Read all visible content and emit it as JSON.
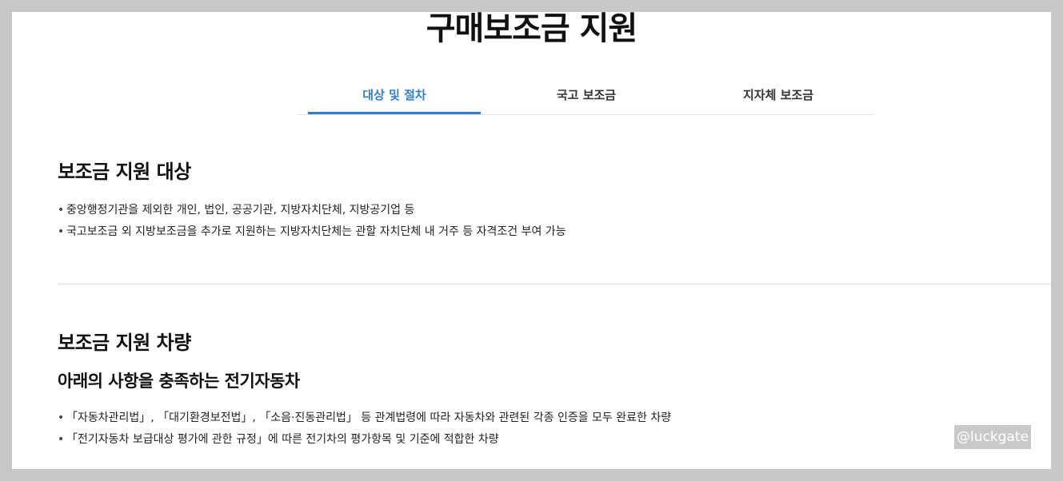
{
  "page": {
    "title": "구매보조금 지원"
  },
  "tabs": [
    {
      "label": "대상 및 절차",
      "active": true
    },
    {
      "label": "국고 보조금",
      "active": false
    },
    {
      "label": "지자체 보조금",
      "active": false
    }
  ],
  "colors": {
    "accent": "#2f7fd1",
    "frame": "#c8c8c8"
  },
  "section1": {
    "heading": "보조금 지원 대상",
    "items": [
      "중앙행정기관을 제외한 개인, 법인, 공공기관, 지방자치단체, 지방공기업 등",
      "국고보조금 외 지방보조금을 추가로 지원하는 지방자치단체는 관할 자치단체 내 거주 등 자격조건 부여 가능"
    ]
  },
  "section2": {
    "heading": "보조금 지원 차량",
    "subheading": "아래의 사항을 충족하는 전기자동차",
    "items": [
      "「자동차관리법」, 「대기환경보전법」, 「소음·진동관리법」 등 관계법령에 따라 자동차와 관련된 각종 인증을 모두 완료한 차량",
      "「전기자동차 보급대상 평가에 관한 규정」에 따른 전기차의 평가항목 및 기준에 적합한 차량"
    ]
  },
  "watermark": "@luckgate"
}
